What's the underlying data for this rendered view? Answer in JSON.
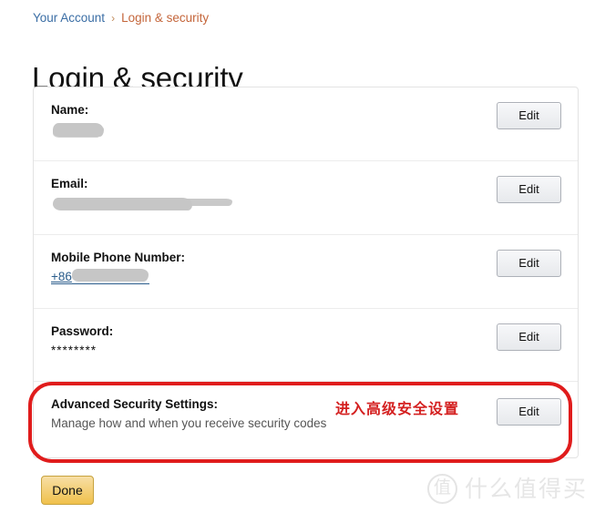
{
  "breadcrumb": {
    "root_label": "Your Account",
    "separator": "›",
    "current_label": "Login & security"
  },
  "page_title": "Login & security",
  "card": {
    "rows": [
      {
        "label": "Name:",
        "value": "",
        "redacted": true,
        "edit_label": "Edit"
      },
      {
        "label": "Email:",
        "value": "",
        "redacted": true,
        "edit_label": "Edit"
      },
      {
        "label": "Mobile Phone Number:",
        "value": "+86",
        "redacted": true,
        "edit_label": "Edit"
      },
      {
        "label": "Password:",
        "value": "********",
        "redacted": false,
        "edit_label": "Edit"
      },
      {
        "label": "Advanced Security Settings:",
        "subtitle": "Manage how and when you receive security codes",
        "redacted": false,
        "edit_label": "Edit"
      }
    ]
  },
  "annotation": {
    "text": "进入高级安全设置",
    "box_color": "#e01c1c",
    "text_color": "#d42020"
  },
  "done_button": {
    "label": "Done",
    "color": "#f0c14b"
  },
  "watermark": {
    "logo_char": "值",
    "text": "什么值得买"
  },
  "colors": {
    "breadcrumb_root": "#3b6ea5",
    "breadcrumb_current": "#c4653a",
    "link": "#2b5d8c",
    "redaction": "#c6c6c6",
    "card_border": "#e3e3e3"
  }
}
